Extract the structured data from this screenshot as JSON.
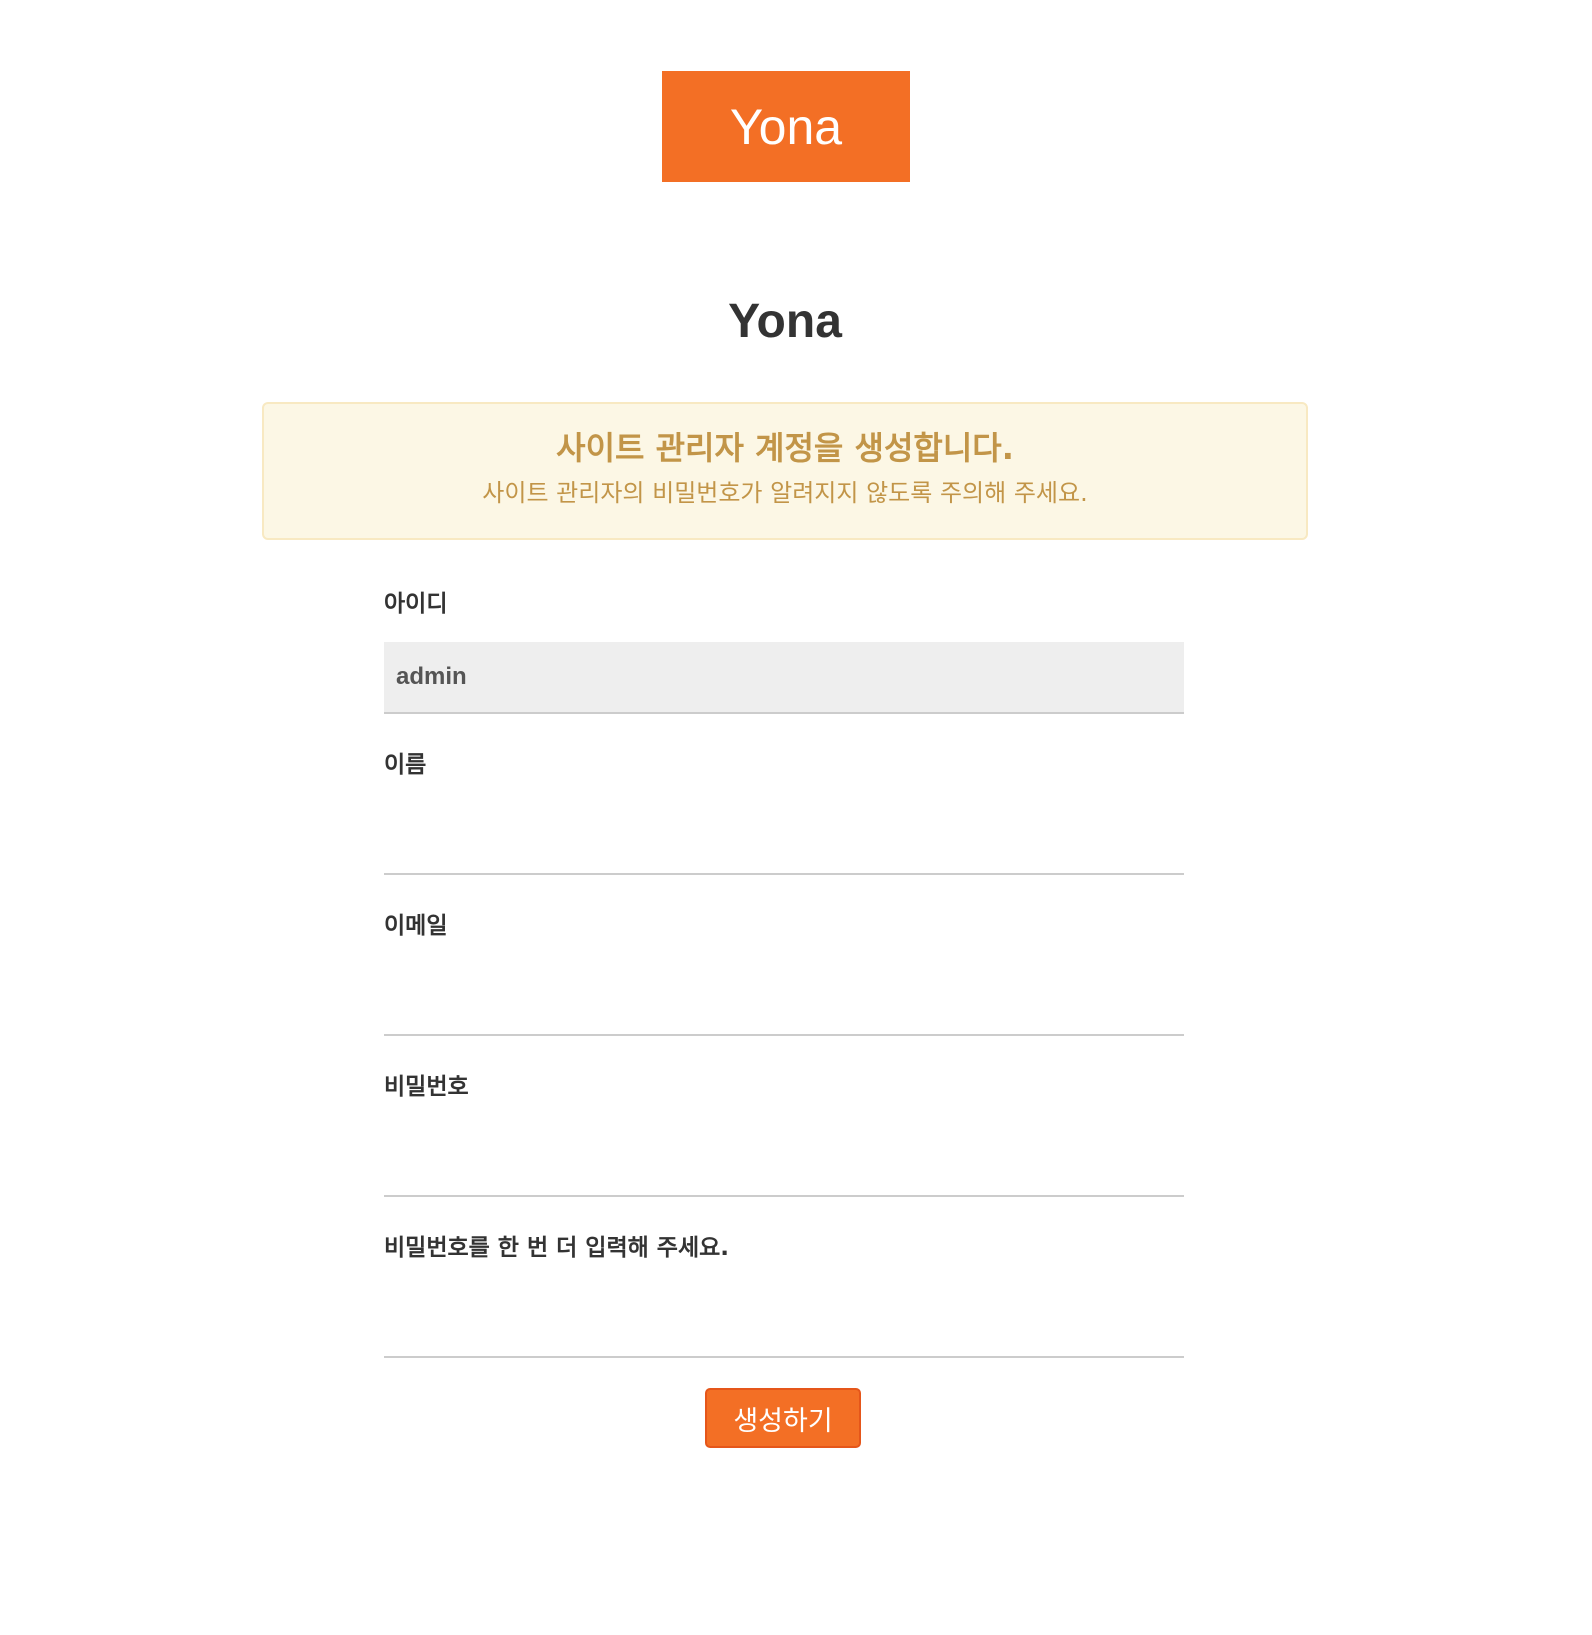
{
  "brand": {
    "logo_text": "Yona",
    "accent_color": "#f36f25"
  },
  "page": {
    "title": "Yona"
  },
  "notice": {
    "title": "사이트 관리자 계정을 생성합니다.",
    "description": "사이트 관리자의 비밀번호가 알려지지 않도록 주의해 주세요.",
    "background_color": "#fcf7e5",
    "text_color": "#c29548"
  },
  "form": {
    "fields": [
      {
        "label": "아이디",
        "value": "admin",
        "placeholder": ""
      },
      {
        "label": "이름",
        "value": "",
        "placeholder": ""
      },
      {
        "label": "이메일",
        "value": "",
        "placeholder": ""
      },
      {
        "label": "비밀번호",
        "value": "",
        "placeholder": ""
      },
      {
        "label": "비밀번호를 한 번 더 입력해 주세요.",
        "value": "",
        "placeholder": ""
      }
    ],
    "submit_label": "생성하기"
  }
}
